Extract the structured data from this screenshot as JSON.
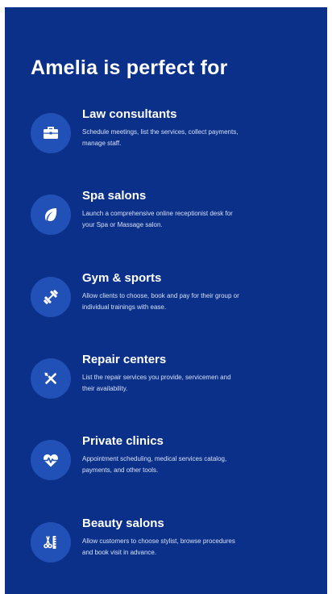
{
  "section": {
    "heading": "Amelia is perfect for"
  },
  "items": [
    {
      "title": "Law consultants",
      "description": "Schedule meetings, list the services, collect payments, manage staff.",
      "icon": "briefcase-icon"
    },
    {
      "title": "Spa salons",
      "description": "Launch a comprehensive online receptionist desk for your Spa or Massage salon.",
      "icon": "leaf-icon"
    },
    {
      "title": "Gym & sports",
      "description": "Allow clients to choose, book and pay for their group or individual trainings with ease.",
      "icon": "dumbbell-icon"
    },
    {
      "title": "Repair centers",
      "description": "List the repair services you provide, servicemen and their availability.",
      "icon": "tools-icon"
    },
    {
      "title": "Private clinics",
      "description": "Appointment scheduling, medical services catalog, payments, and other tools.",
      "icon": "heartbeat-icon"
    },
    {
      "title": "Beauty salons",
      "description": "Allow customers to choose stylist, browse procedures and book visit in advance.",
      "icon": "scissors-comb-icon"
    }
  ],
  "colors": {
    "panel_background": "#0a3089",
    "icon_circle": "#2151b6",
    "text": "#ffffff",
    "description_text": "#d7e0f5"
  }
}
